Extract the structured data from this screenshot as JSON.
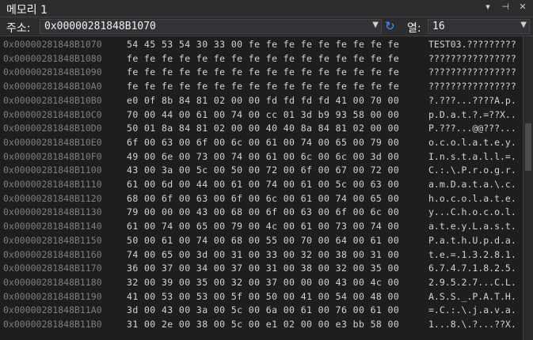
{
  "window": {
    "title": "메모리 1",
    "pin_glyph": "▾",
    "dock_glyph": "⊣",
    "close_glyph": "✕"
  },
  "toolbar": {
    "address_label": "주소:",
    "address_value": "0x00000281848B1070",
    "columns_label": "열:",
    "columns_value": "16",
    "refresh_glyph": "↻"
  },
  "rows": [
    {
      "addr": "0x00000281848B1070",
      "bytes": "54 45 53 54 30 33 00 fe fe fe fe fe fe fe fe fe",
      "ascii": "TEST03.?????????"
    },
    {
      "addr": "0x00000281848B1080",
      "bytes": "fe fe fe fe fe fe fe fe fe fe fe fe fe fe fe fe",
      "ascii": "????????????????"
    },
    {
      "addr": "0x00000281848B1090",
      "bytes": "fe fe fe fe fe fe fe fe fe fe fe fe fe fe fe fe",
      "ascii": "????????????????"
    },
    {
      "addr": "0x00000281848B10A0",
      "bytes": "fe fe fe fe fe fe fe fe fe fe fe fe fe fe fe fe",
      "ascii": "????????????????"
    },
    {
      "addr": "0x00000281848B10B0",
      "bytes": "e0 0f 8b 84 81 02 00 00 fd fd fd fd 41 00 70 00",
      "ascii": "?.???...????A.p."
    },
    {
      "addr": "0x00000281848B10C0",
      "bytes": "70 00 44 00 61 00 74 00 cc 01 3d b9 93 58 00 00",
      "ascii": "p.D.a.t.?.=??X.."
    },
    {
      "addr": "0x00000281848B10D0",
      "bytes": "50 01 8a 84 81 02 00 00 40 40 8a 84 81 02 00 00",
      "ascii": "P.???...@@???..."
    },
    {
      "addr": "0x00000281848B10E0",
      "bytes": "6f 00 63 00 6f 00 6c 00 61 00 74 00 65 00 79 00",
      "ascii": "o.c.o.l.a.t.e.y."
    },
    {
      "addr": "0x00000281848B10F0",
      "bytes": "49 00 6e 00 73 00 74 00 61 00 6c 00 6c 00 3d 00",
      "ascii": "I.n.s.t.a.l.l.=."
    },
    {
      "addr": "0x00000281848B1100",
      "bytes": "43 00 3a 00 5c 00 50 00 72 00 6f 00 67 00 72 00",
      "ascii": "C.:.\\.P.r.o.g.r."
    },
    {
      "addr": "0x00000281848B1110",
      "bytes": "61 00 6d 00 44 00 61 00 74 00 61 00 5c 00 63 00",
      "ascii": "a.m.D.a.t.a.\\.c."
    },
    {
      "addr": "0x00000281848B1120",
      "bytes": "68 00 6f 00 63 00 6f 00 6c 00 61 00 74 00 65 00",
      "ascii": "h.o.c.o.l.a.t.e."
    },
    {
      "addr": "0x00000281848B1130",
      "bytes": "79 00 00 00 43 00 68 00 6f 00 63 00 6f 00 6c 00",
      "ascii": "y...C.h.o.c.o.l."
    },
    {
      "addr": "0x00000281848B1140",
      "bytes": "61 00 74 00 65 00 79 00 4c 00 61 00 73 00 74 00",
      "ascii": "a.t.e.y.L.a.s.t."
    },
    {
      "addr": "0x00000281848B1150",
      "bytes": "50 00 61 00 74 00 68 00 55 00 70 00 64 00 61 00",
      "ascii": "P.a.t.h.U.p.d.a."
    },
    {
      "addr": "0x00000281848B1160",
      "bytes": "74 00 65 00 3d 00 31 00 33 00 32 00 38 00 31 00",
      "ascii": "t.e.=.1.3.2.8.1."
    },
    {
      "addr": "0x00000281848B1170",
      "bytes": "36 00 37 00 34 00 37 00 31 00 38 00 32 00 35 00",
      "ascii": "6.7.4.7.1.8.2.5."
    },
    {
      "addr": "0x00000281848B1180",
      "bytes": "32 00 39 00 35 00 32 00 37 00 00 00 43 00 4c 00",
      "ascii": "2.9.5.2.7...C.L."
    },
    {
      "addr": "0x00000281848B1190",
      "bytes": "41 00 53 00 53 00 5f 00 50 00 41 00 54 00 48 00",
      "ascii": "A.S.S._.P.A.T.H."
    },
    {
      "addr": "0x00000281848B11A0",
      "bytes": "3d 00 43 00 3a 00 5c 00 6a 00 61 00 76 00 61 00",
      "ascii": "=.C.:.\\.j.a.v.a."
    },
    {
      "addr": "0x00000281848B11B0",
      "bytes": "31 00 2e 00 38 00 5c 00 e1 02 00 00 e3 bb 58 00",
      "ascii": "1...8.\\.?...??X."
    }
  ]
}
